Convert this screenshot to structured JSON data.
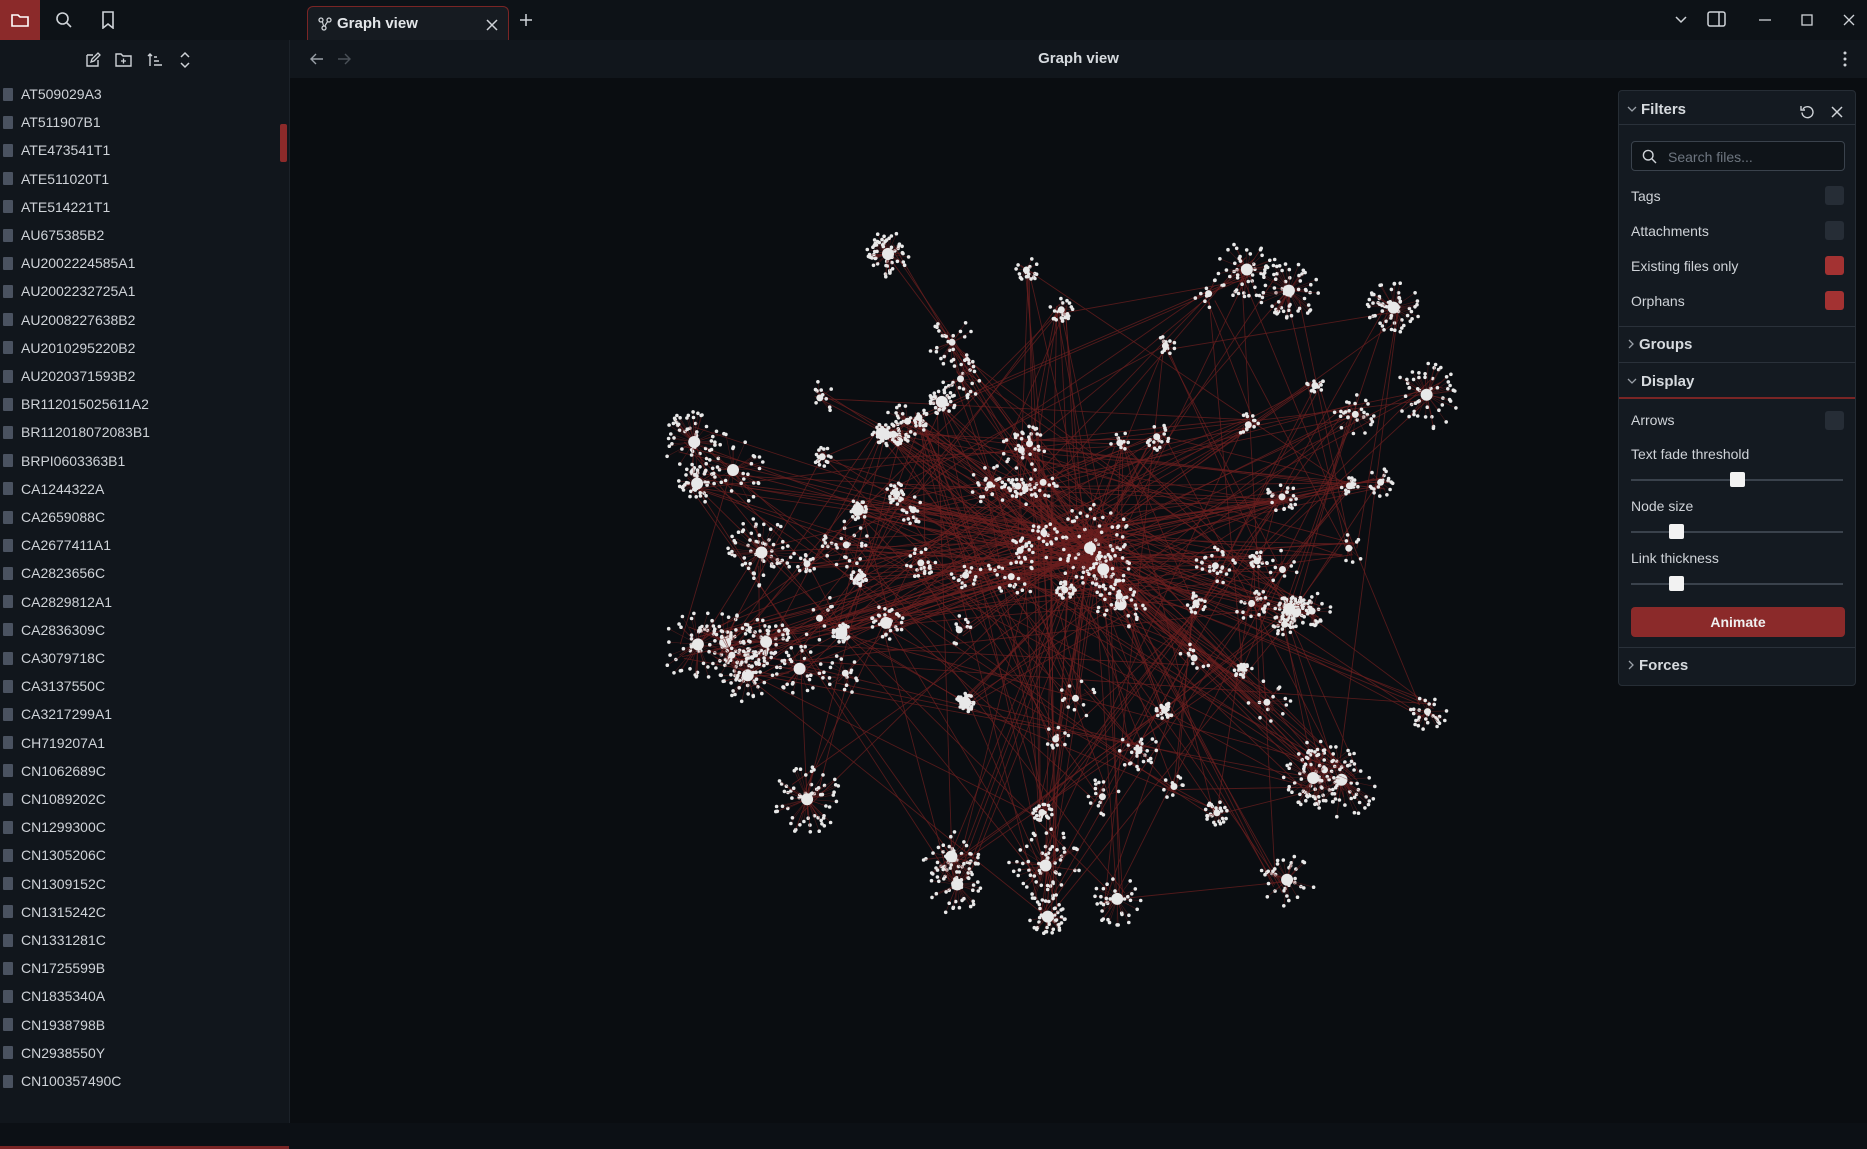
{
  "tab": {
    "title": "Graph view"
  },
  "view": {
    "title": "Graph view"
  },
  "sidebar": {
    "files": [
      "AT509029A3",
      "AT511907B1",
      "ATE473541T1",
      "ATE511020T1",
      "ATE514221T1",
      "AU675385B2",
      "AU2002224585A1",
      "AU2002232725A1",
      "AU2008227638B2",
      "AU2010295220B2",
      "AU2020371593B2",
      "BR112015025611A2",
      "BR112018072083B1",
      "BRPI0603363B1",
      "CA1244322A",
      "CA2659088C",
      "CA2677411A1",
      "CA2823656C",
      "CA2829812A1",
      "CA2836309C",
      "CA3079718C",
      "CA3137550C",
      "CA3217299A1",
      "CH719207A1",
      "CN1062689C",
      "CN1089202C",
      "CN1299300C",
      "CN1305206C",
      "CN1309152C",
      "CN1315242C",
      "CN1331281C",
      "CN1725599B",
      "CN1835340A",
      "CN1938798B",
      "CN2938550Y",
      "CN100357490C"
    ]
  },
  "filters": {
    "title": "Filters",
    "search_placeholder": "Search files...",
    "tags_label": "Tags",
    "attachments_label": "Attachments",
    "existing_label": "Existing files only",
    "orphans_label": "Orphans",
    "tags_on": false,
    "attachments_on": false,
    "existing_on": true,
    "orphans_on": true
  },
  "groups": {
    "title": "Groups"
  },
  "display": {
    "title": "Display",
    "arrows_label": "Arrows",
    "arrows_on": false,
    "text_fade_label": "Text fade threshold",
    "text_fade_value": 0.5,
    "node_size_label": "Node size",
    "node_size_value": 0.21,
    "link_thickness_label": "Link thickness",
    "link_thickness_value": 0.21,
    "animate_label": "Animate"
  },
  "forces": {
    "title": "Forces"
  },
  "colors": {
    "accent": "#8b2a2a",
    "check_on": "#a33232",
    "graph_link": "#6b1f1f",
    "graph_node": "#e8e8e8"
  }
}
